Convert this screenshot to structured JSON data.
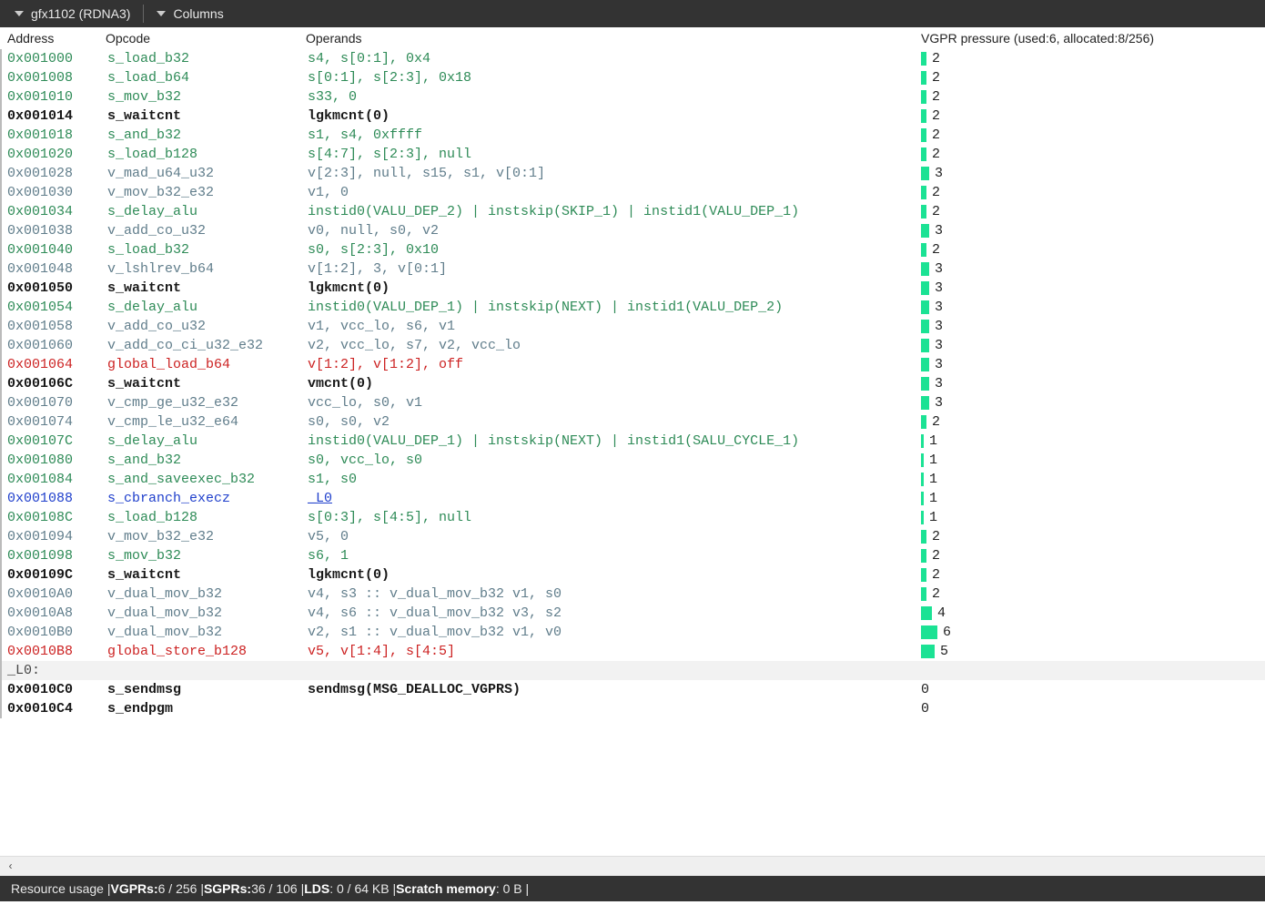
{
  "topbar": {
    "arch": "gfx1102 (RDNA3)",
    "columns": "Columns"
  },
  "headers": {
    "address": "Address",
    "opcode": "Opcode",
    "operands": "Operands",
    "pressure": "VGPR pressure (used:6, allocated:8/256)"
  },
  "rows": [
    {
      "addr": "0x001000",
      "op": "s_load_b32",
      "cls": "salu",
      "oper": "s4, s[0:1], 0x4",
      "p": 2
    },
    {
      "addr": "0x001008",
      "op": "s_load_b64",
      "cls": "salu",
      "oper": "s[0:1], s[2:3], 0x18",
      "p": 2
    },
    {
      "addr": "0x001010",
      "op": "s_mov_b32",
      "cls": "salu",
      "oper": "s33, 0",
      "p": 2
    },
    {
      "addr": "0x001014",
      "op": "s_waitcnt",
      "cls": "black",
      "oper": "lgkmcnt(0)",
      "p": 2
    },
    {
      "addr": "0x001018",
      "op": "s_and_b32",
      "cls": "salu",
      "oper": "s1, s4, 0xffff",
      "p": 2
    },
    {
      "addr": "0x001020",
      "op": "s_load_b128",
      "cls": "salu",
      "oper": "s[4:7], s[2:3], null",
      "p": 2
    },
    {
      "addr": "0x001028",
      "op": "v_mad_u64_u32",
      "cls": "valu",
      "oper": "v[2:3], null, s15, s1, v[0:1]",
      "p": 3
    },
    {
      "addr": "0x001030",
      "op": "v_mov_b32_e32",
      "cls": "valu",
      "oper": "v1, 0",
      "p": 2
    },
    {
      "addr": "0x001034",
      "op": "s_delay_alu",
      "cls": "salu",
      "oper": "instid0(VALU_DEP_2) | instskip(SKIP_1) | instid1(VALU_DEP_1)",
      "p": 2
    },
    {
      "addr": "0x001038",
      "op": "v_add_co_u32",
      "cls": "valu",
      "oper": "v0, null, s0, v2",
      "p": 3
    },
    {
      "addr": "0x001040",
      "op": "s_load_b32",
      "cls": "salu",
      "oper": "s0, s[2:3], 0x10",
      "p": 2
    },
    {
      "addr": "0x001048",
      "op": "v_lshlrev_b64",
      "cls": "valu",
      "oper": "v[1:2], 3, v[0:1]",
      "p": 3
    },
    {
      "addr": "0x001050",
      "op": "s_waitcnt",
      "cls": "black",
      "oper": "lgkmcnt(0)",
      "p": 3
    },
    {
      "addr": "0x001054",
      "op": "s_delay_alu",
      "cls": "salu",
      "oper": "instid0(VALU_DEP_1) | instskip(NEXT) | instid1(VALU_DEP_2)",
      "p": 3
    },
    {
      "addr": "0x001058",
      "op": "v_add_co_u32",
      "cls": "valu",
      "oper": "v1, vcc_lo, s6, v1",
      "p": 3
    },
    {
      "addr": "0x001060",
      "op": "v_add_co_ci_u32_e32",
      "cls": "valu",
      "oper": "v2, vcc_lo, s7, v2, vcc_lo",
      "p": 3
    },
    {
      "addr": "0x001064",
      "op": "global_load_b64",
      "cls": "mem",
      "oper": "v[1:2], v[1:2], off",
      "p": 3
    },
    {
      "addr": "0x00106C",
      "op": "s_waitcnt",
      "cls": "black",
      "oper": "vmcnt(0)",
      "p": 3
    },
    {
      "addr": "0x001070",
      "op": "v_cmp_ge_u32_e32",
      "cls": "valu",
      "oper": "vcc_lo, s0, v1",
      "p": 3
    },
    {
      "addr": "0x001074",
      "op": "v_cmp_le_u32_e64",
      "cls": "valu",
      "oper": "s0, s0, v2",
      "p": 2
    },
    {
      "addr": "0x00107C",
      "op": "s_delay_alu",
      "cls": "salu",
      "oper": "instid0(VALU_DEP_1) | instskip(NEXT) | instid1(SALU_CYCLE_1)",
      "p": 1
    },
    {
      "addr": "0x001080",
      "op": "s_and_b32",
      "cls": "salu",
      "oper": "s0, vcc_lo, s0",
      "p": 1
    },
    {
      "addr": "0x001084",
      "op": "s_and_saveexec_b32",
      "cls": "salu",
      "oper": "s1, s0",
      "p": 1
    },
    {
      "addr": "0x001088",
      "op": "s_cbranch_execz",
      "cls": "br",
      "oper": "_L0",
      "p": 1,
      "link": true
    },
    {
      "addr": "0x00108C",
      "op": "s_load_b128",
      "cls": "salu",
      "oper": "s[0:3], s[4:5], null",
      "p": 1
    },
    {
      "addr": "0x001094",
      "op": "v_mov_b32_e32",
      "cls": "valu",
      "oper": "v5, 0",
      "p": 2
    },
    {
      "addr": "0x001098",
      "op": "s_mov_b32",
      "cls": "salu",
      "oper": "s6, 1",
      "p": 2
    },
    {
      "addr": "0x00109C",
      "op": "s_waitcnt",
      "cls": "black",
      "oper": "lgkmcnt(0)",
      "p": 2
    },
    {
      "addr": "0x0010A0",
      "op": "v_dual_mov_b32",
      "cls": "valu",
      "oper": "v4, s3 :: v_dual_mov_b32 v1, s0",
      "p": 2
    },
    {
      "addr": "0x0010A8",
      "op": "v_dual_mov_b32",
      "cls": "valu",
      "oper": "v4, s6 :: v_dual_mov_b32 v3, s2",
      "p": 4
    },
    {
      "addr": "0x0010B0",
      "op": "v_dual_mov_b32",
      "cls": "valu",
      "oper": "v2, s1 :: v_dual_mov_b32 v1, v0",
      "p": 6
    },
    {
      "addr": "0x0010B8",
      "op": "global_store_b128",
      "cls": "mem",
      "oper": "v5, v[1:4], s[4:5]",
      "p": 5
    },
    {
      "label": "_L0:"
    },
    {
      "addr": "0x0010C0",
      "op": "s_sendmsg",
      "cls": "black",
      "oper": "sendmsg(MSG_DEALLOC_VGPRS)",
      "p": 0
    },
    {
      "addr": "0x0010C4",
      "op": "s_endpgm",
      "cls": "black",
      "oper": "",
      "p": 0
    }
  ],
  "footer": {
    "lead": "Resource usage | ",
    "vgprs_k": "VGPRs:",
    "vgprs_v": " 6 / 256 | ",
    "sgprs_k": "SGPRs:",
    "sgprs_v": " 36 / 106 | ",
    "lds_k": "LDS",
    "lds_v": ": 0 / 64 KB | ",
    "scr_k": "Scratch memory",
    "scr_v": ": 0 B |"
  }
}
